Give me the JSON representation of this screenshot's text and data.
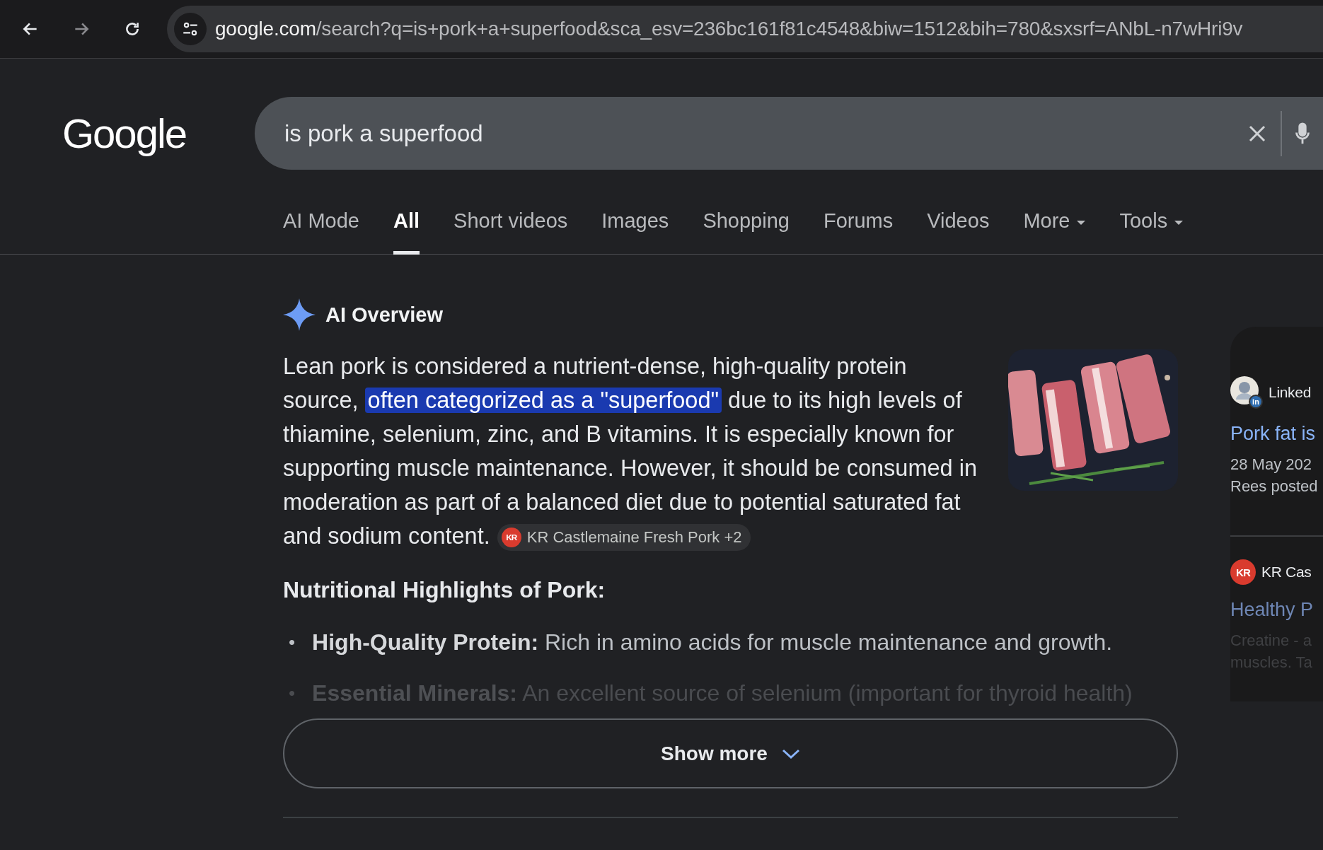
{
  "browser": {
    "url_host": "google.com",
    "url_rest": "/search?q=is+pork+a+superfood&sca_esv=236bc161f81c4548&biw=1512&bih=780&sxsrf=ANbL-n7wHri9v",
    "forward_disabled": true
  },
  "logo": "Google",
  "search": {
    "query": "is pork a superfood"
  },
  "tabs": [
    {
      "label": "AI Mode",
      "selected": false,
      "dropdown": false
    },
    {
      "label": "All",
      "selected": true,
      "dropdown": false
    },
    {
      "label": "Short videos",
      "selected": false,
      "dropdown": false
    },
    {
      "label": "Images",
      "selected": false,
      "dropdown": false
    },
    {
      "label": "Shopping",
      "selected": false,
      "dropdown": false
    },
    {
      "label": "Forums",
      "selected": false,
      "dropdown": false
    },
    {
      "label": "Videos",
      "selected": false,
      "dropdown": false
    },
    {
      "label": "More",
      "selected": false,
      "dropdown": true
    },
    {
      "label": "Tools",
      "selected": false,
      "dropdown": true
    }
  ],
  "ai_overview": {
    "title": "AI Overview",
    "paragraph": [
      {
        "text": "Lean pork is considered a nutrient-dense, high-quality protein source, ",
        "highlighted": false
      },
      {
        "text": "often categorized as a \"superfood\"",
        "highlighted": true
      },
      {
        "text": " due to its high levels of thiamine, selenium, zinc, and B vitamins. It is especially known for supporting muscle maintenance. However, it should be consumed in moderation as part of a balanced diet due to potential saturated fat and sodium content.",
        "highlighted": false
      }
    ],
    "citation": {
      "logo": "KR",
      "label": "KR Castlemaine Fresh Pork +2"
    },
    "heading": "Nutritional Highlights of Pork:",
    "bullets": [
      {
        "marker": "•",
        "term": "High-Quality Protein:",
        "text": "Rich in amino acids for muscle maintenance and growth.",
        "faded": false
      },
      {
        "marker": "•",
        "term": "Essential Minerals:",
        "text": "An excellent source of selenium (important for thyroid health)",
        "faded": true
      }
    ],
    "show_more": "Show more"
  },
  "sources": [
    {
      "kind": "profile",
      "source": "Linked",
      "title": "Pork fat is",
      "lines": [
        "28 May 202",
        "Rees posted"
      ],
      "logo": "in",
      "faded": false
    },
    {
      "kind": "site",
      "source": "KR Cas",
      "title": "Healthy P",
      "lines": [
        "Creatine - a",
        "muscles. Ta"
      ],
      "logo": "KR",
      "faded": true
    }
  ]
}
